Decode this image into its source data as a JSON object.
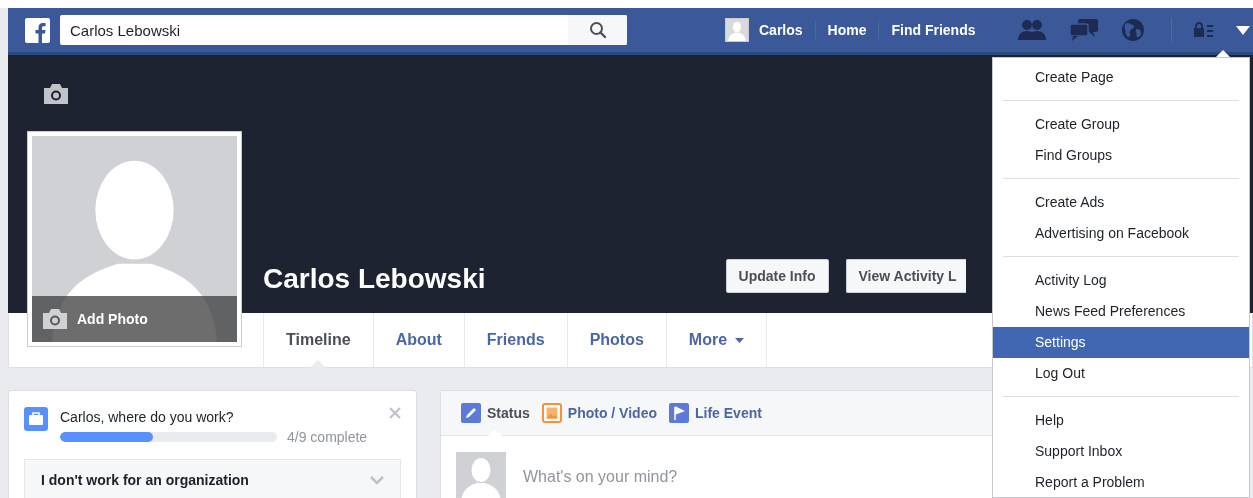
{
  "topbar": {
    "search": {
      "value": "Carlos Lebowski"
    },
    "nav": [
      {
        "label": "Carlos",
        "kind": "profile"
      },
      {
        "label": "Home",
        "kind": "link"
      },
      {
        "label": "Find Friends",
        "kind": "link"
      }
    ]
  },
  "cover": {
    "name": "Carlos Lebowski",
    "add_photo": "Add Photo",
    "buttons": [
      "Update Info",
      "View Activity L"
    ]
  },
  "tabs": [
    {
      "label": "Timeline",
      "selected": true,
      "kind": "tab"
    },
    {
      "label": "About",
      "selected": false,
      "kind": "tab"
    },
    {
      "label": "Friends",
      "selected": false,
      "kind": "tab"
    },
    {
      "label": "Photos",
      "selected": false,
      "kind": "tab"
    },
    {
      "label": "More",
      "selected": false,
      "kind": "dropdown"
    }
  ],
  "work_card": {
    "question": "Carlos, where do you work?",
    "level": 0.43,
    "progress": "4/9 complete",
    "option": "I don't work for an organization"
  },
  "composer": {
    "tabs": [
      {
        "label": "Status",
        "selected": true,
        "kind": "status"
      },
      {
        "label": "Photo / Video",
        "selected": false,
        "kind": "photo"
      },
      {
        "label": "Life Event",
        "selected": false,
        "kind": "event"
      }
    ],
    "placeholder": "What's on your mind?"
  },
  "menu": {
    "groups": [
      [
        {
          "label": "Create Page",
          "selected": false
        }
      ],
      [
        {
          "label": "Create Group",
          "selected": false
        },
        {
          "label": "Find Groups",
          "selected": false
        }
      ],
      [
        {
          "label": "Create Ads",
          "selected": false
        },
        {
          "label": "Advertising on Facebook",
          "selected": false
        }
      ],
      [
        {
          "label": "Activity Log",
          "selected": false
        },
        {
          "label": "News Feed Preferences",
          "selected": false
        },
        {
          "label": "Settings",
          "selected": true
        },
        {
          "label": "Log Out",
          "selected": false
        }
      ],
      [
        {
          "label": "Help",
          "selected": false
        },
        {
          "label": "Support Inbox",
          "selected": false
        },
        {
          "label": "Report a Problem",
          "selected": false
        }
      ]
    ]
  }
}
